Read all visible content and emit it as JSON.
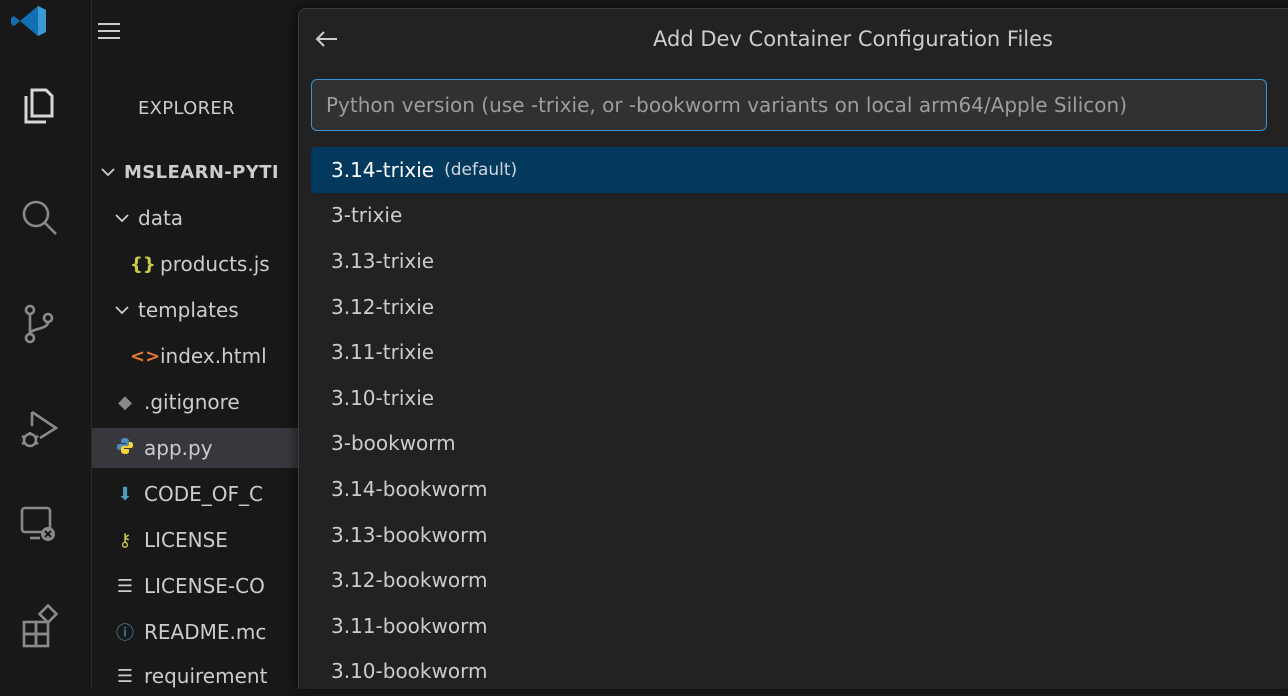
{
  "quickpick": {
    "title": "Add Dev Container Configuration Files",
    "placeholder": "Python version (use -trixie, or -bookworm variants on local arm64/Apple Silicon)",
    "items": [
      {
        "label": "3.14-trixie",
        "description": "(default)"
      },
      {
        "label": "3-trixie"
      },
      {
        "label": "3.13-trixie"
      },
      {
        "label": "3.12-trixie"
      },
      {
        "label": "3.11-trixie"
      },
      {
        "label": "3.10-trixie"
      },
      {
        "label": "3-bookworm"
      },
      {
        "label": "3.14-bookworm"
      },
      {
        "label": "3.13-bookworm"
      },
      {
        "label": "3.12-bookworm"
      },
      {
        "label": "3.11-bookworm"
      },
      {
        "label": "3.10-bookworm"
      }
    ],
    "accent_color": "#04395e",
    "focus_border_color": "#3994d9"
  },
  "sidebar": {
    "title": "EXPLORER",
    "root": "MSLEARN-PYTI",
    "tree": [
      {
        "label": "data",
        "icon": "chevron-down-icon"
      },
      {
        "label": "products.js",
        "icon": "json-icon"
      },
      {
        "label": "templates",
        "icon": "chevron-down-icon"
      },
      {
        "label": "index.html",
        "icon": "html-icon"
      },
      {
        "label": ".gitignore",
        "icon": "git-icon"
      },
      {
        "label": "app.py",
        "icon": "python-icon"
      },
      {
        "label": "CODE_OF_C",
        "icon": "markdown-download-icon"
      },
      {
        "label": "LICENSE",
        "icon": "license-icon"
      },
      {
        "label": "LICENSE-CO",
        "icon": "text-lines-icon"
      },
      {
        "label": "README.mc",
        "icon": "info-icon"
      },
      {
        "label": "requirement",
        "icon": "text-lines-icon"
      }
    ]
  },
  "activity_bar": {
    "icons": [
      "vscode-logo",
      "explorer-icon",
      "search-icon",
      "source-control-icon",
      "run-debug-icon",
      "remote-explorer-icon",
      "extensions-icon"
    ]
  }
}
